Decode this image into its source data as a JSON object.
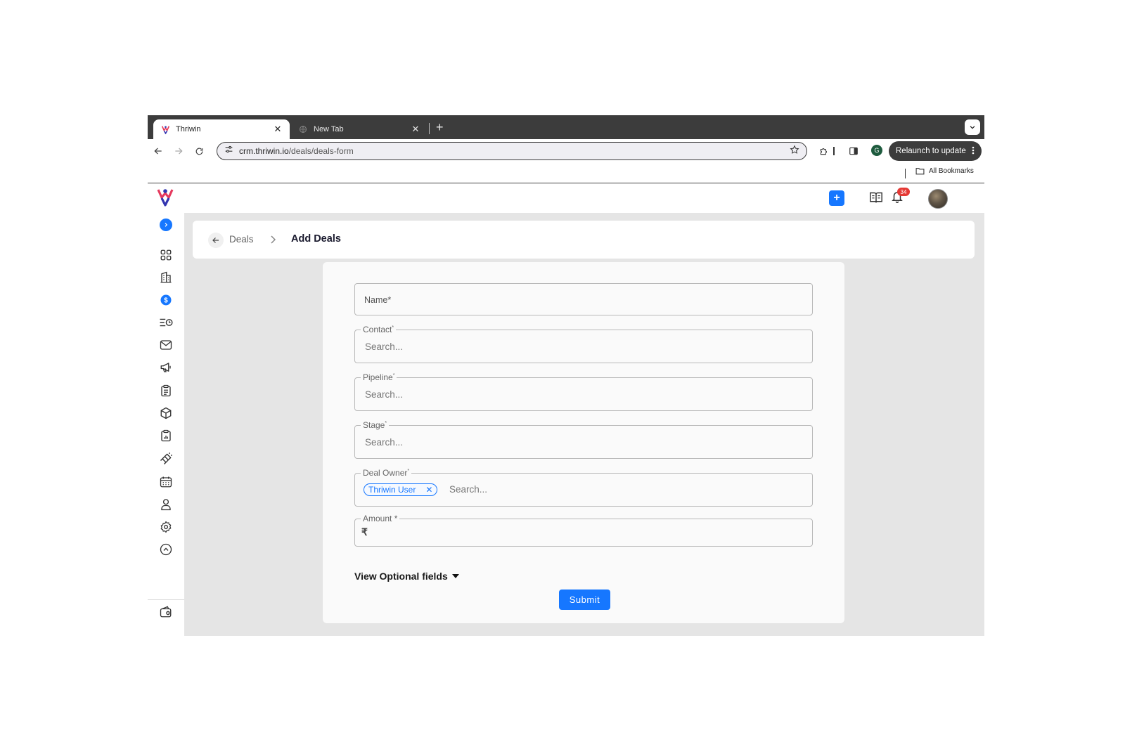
{
  "browser": {
    "tabs": [
      {
        "title": "Thriwin",
        "active": true
      },
      {
        "title": "New Tab",
        "active": false
      }
    ],
    "url_host": "crm.thriwin.io",
    "url_path": "/deals/deals-form",
    "profile_initial": "G",
    "relaunch_label": "Relaunch to update",
    "bookmarks_label": "All Bookmarks"
  },
  "header": {
    "notification_count": "34"
  },
  "breadcrumb": {
    "parent": "Deals",
    "current": "Add Deals"
  },
  "form": {
    "name_label": "Name*",
    "contact": {
      "label": "Contact",
      "required_mark": "*",
      "placeholder": "Search..."
    },
    "pipeline": {
      "label": "Pipeline",
      "required_mark": "*",
      "placeholder": "Search..."
    },
    "stage": {
      "label": "Stage",
      "required_mark": "*",
      "placeholder": "Search..."
    },
    "deal_owner": {
      "label": "Deal Owner",
      "required_mark": "*",
      "chip": "Thriwin User",
      "placeholder": "Search..."
    },
    "amount": {
      "label": "Amount *",
      "currency_symbol": "₹"
    },
    "optional_label": "View Optional fields",
    "submit_label": "Submit"
  },
  "colors": {
    "primary": "#1677ff",
    "badge": "#e53935",
    "chrome_dark": "#3c3c3c"
  }
}
